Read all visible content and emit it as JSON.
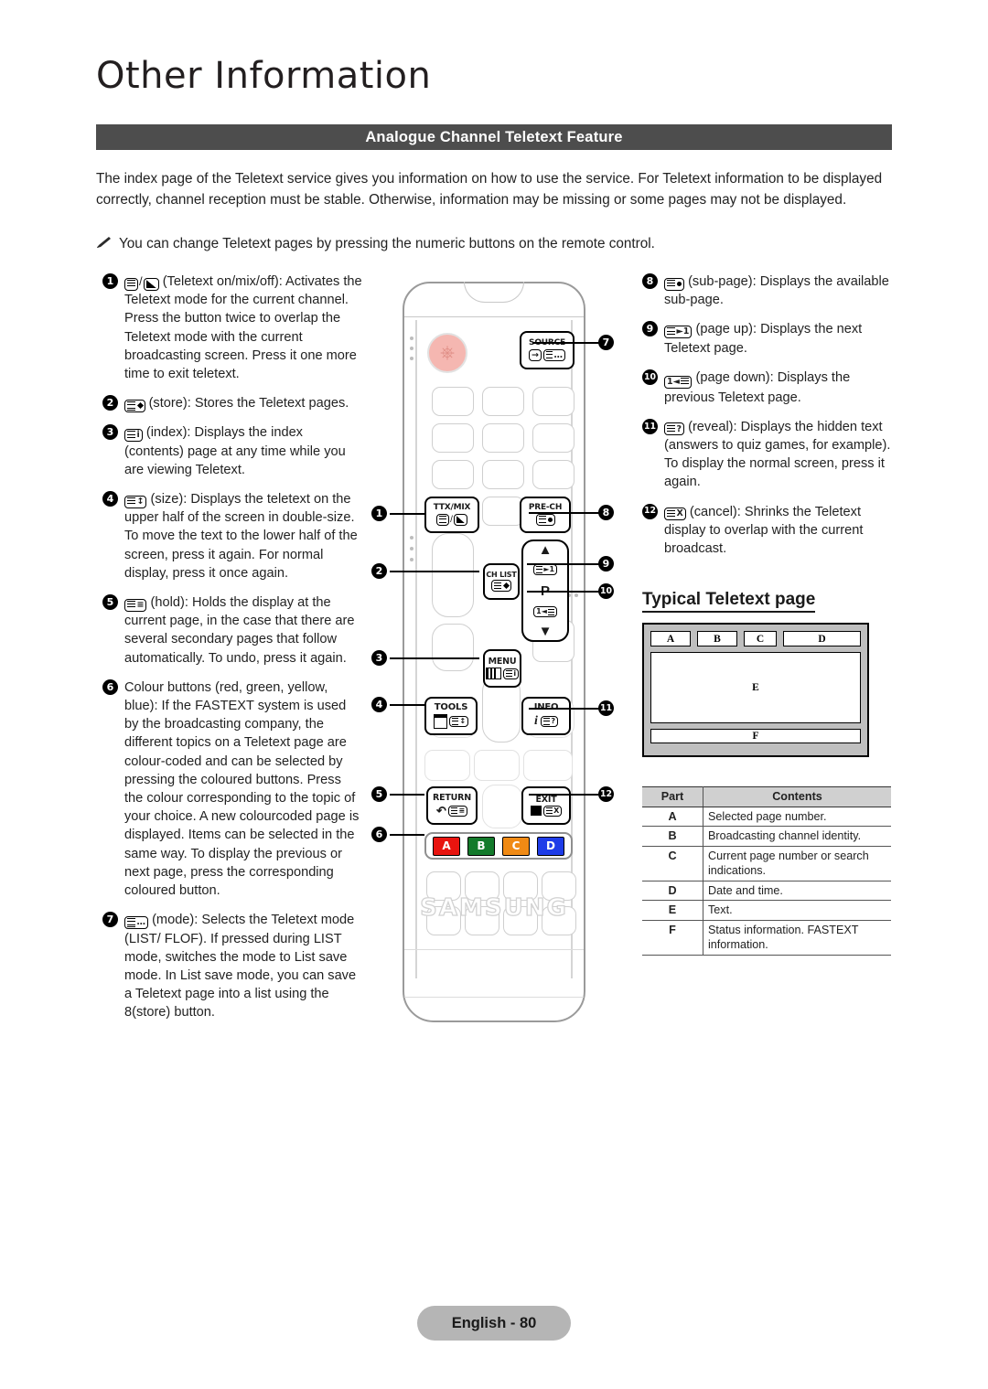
{
  "header": {
    "chapter_title": "Other Information",
    "section_title": "Analogue Channel Teletext Feature"
  },
  "intro": {
    "paragraph": "The index page of the Teletext service gives you information on how to use the service. For Teletext information to be displayed correctly, channel reception must be stable. Otherwise, information may be missing or some pages may not be displayed.",
    "note": "You can change Teletext pages by pressing the numeric buttons on the remote control.",
    "note_icon": "pencil-icon"
  },
  "left_column": [
    {
      "num": "1",
      "icon": "teletext-onmixoff-icon",
      "text": "(Teletext on/mix/off): Activates the Teletext mode for the current channel. Press the button twice to overlap the Teletext mode with the current broadcasting screen. Press it one more time to exit teletext."
    },
    {
      "num": "2",
      "icon": "teletext-store-icon",
      "text": "(store): Stores the Teletext pages."
    },
    {
      "num": "3",
      "icon": "teletext-index-icon",
      "text": "(index): Displays the index (contents) page at any time while you are viewing Teletext."
    },
    {
      "num": "4",
      "icon": "teletext-size-icon",
      "text": "(size): Displays the teletext on the upper half of the screen in double-size. To move the text to the lower half of the screen, press it again. For normal display, press it once again."
    },
    {
      "num": "5",
      "icon": "teletext-hold-icon",
      "text": "(hold): Holds the display at the current page, in the case that there are several secondary pages that follow automatically. To undo, press it again."
    },
    {
      "num": "6",
      "icon": "",
      "text": "Colour buttons (red, green, yellow, blue): If the FASTEXT system is used by the broadcasting company, the different topics on a Teletext page are colour-coded and can be selected by pressing the coloured buttons. Press the colour corresponding to the topic of your choice. A new colourcoded page is displayed. Items can be selected in the same way. To display the previous or next page, press the corresponding coloured button."
    },
    {
      "num": "7",
      "icon": "teletext-mode-icon",
      "text": "(mode): Selects the Teletext mode (LIST/ FLOF). If pressed during LIST mode, switches the mode to List save mode. In List save mode, you can save a Teletext page into a list using the 8(store) button."
    }
  ],
  "right_column": [
    {
      "num": "8",
      "icon": "teletext-subpage-icon",
      "text": "(sub-page): Displays the available sub-page."
    },
    {
      "num": "9",
      "icon": "teletext-pageup-icon",
      "text": "(page up): Displays the next Teletext page."
    },
    {
      "num": "10",
      "icon": "teletext-pagedown-icon",
      "text": "(page down): Displays the previous Teletext page."
    },
    {
      "num": "11",
      "icon": "teletext-reveal-icon",
      "text": "(reveal): Displays the hidden text (answers to quiz games, for example). To display the normal screen, press it again."
    },
    {
      "num": "12",
      "icon": "teletext-cancel-icon",
      "text": "(cancel): Shrinks the Teletext display to overlap with the current broadcast."
    }
  ],
  "typical_page": {
    "title": "Typical Teletext page",
    "labels": {
      "a": "A",
      "b": "B",
      "c": "C",
      "d": "D",
      "e": "E",
      "f": "F"
    }
  },
  "table": {
    "headers": [
      "Part",
      "Contents"
    ],
    "rows": [
      {
        "part": "A",
        "contents": "Selected page number."
      },
      {
        "part": "B",
        "contents": "Broadcasting channel identity."
      },
      {
        "part": "C",
        "contents": "Current page number or search indications."
      },
      {
        "part": "D",
        "contents": "Date and time."
      },
      {
        "part": "E",
        "contents": "Text."
      },
      {
        "part": "F",
        "contents": "Status information. FASTEXT information."
      }
    ]
  },
  "remote": {
    "brand": "SAMSUNG",
    "keys": {
      "source": "SOURCE",
      "pre_ch": "PRE-CH",
      "ttx_mix": "TTX/MIX",
      "ch_list": "CH LIST",
      "menu": "MENU",
      "tools": "TOOLS",
      "info": "INFO",
      "return": "RETURN",
      "exit": "EXIT",
      "p_label": "P"
    },
    "colour_buttons": [
      {
        "label": "A",
        "colour": "#e8140f"
      },
      {
        "label": "B",
        "colour": "#137a2b"
      },
      {
        "label": "C",
        "colour": "#f08a14"
      },
      {
        "label": "D",
        "colour": "#1e3ce8"
      }
    ],
    "callouts": [
      "1",
      "2",
      "3",
      "4",
      "5",
      "6",
      "7",
      "8",
      "9",
      "10",
      "11",
      "12"
    ]
  },
  "footer": {
    "page_label": "English - 80"
  },
  "colors": {
    "section_bar": "#4d4d4d",
    "footer_pill": "#b5b5b5",
    "diagram_frame": "#bfbfbf",
    "table_header": "#d0d0d0"
  }
}
